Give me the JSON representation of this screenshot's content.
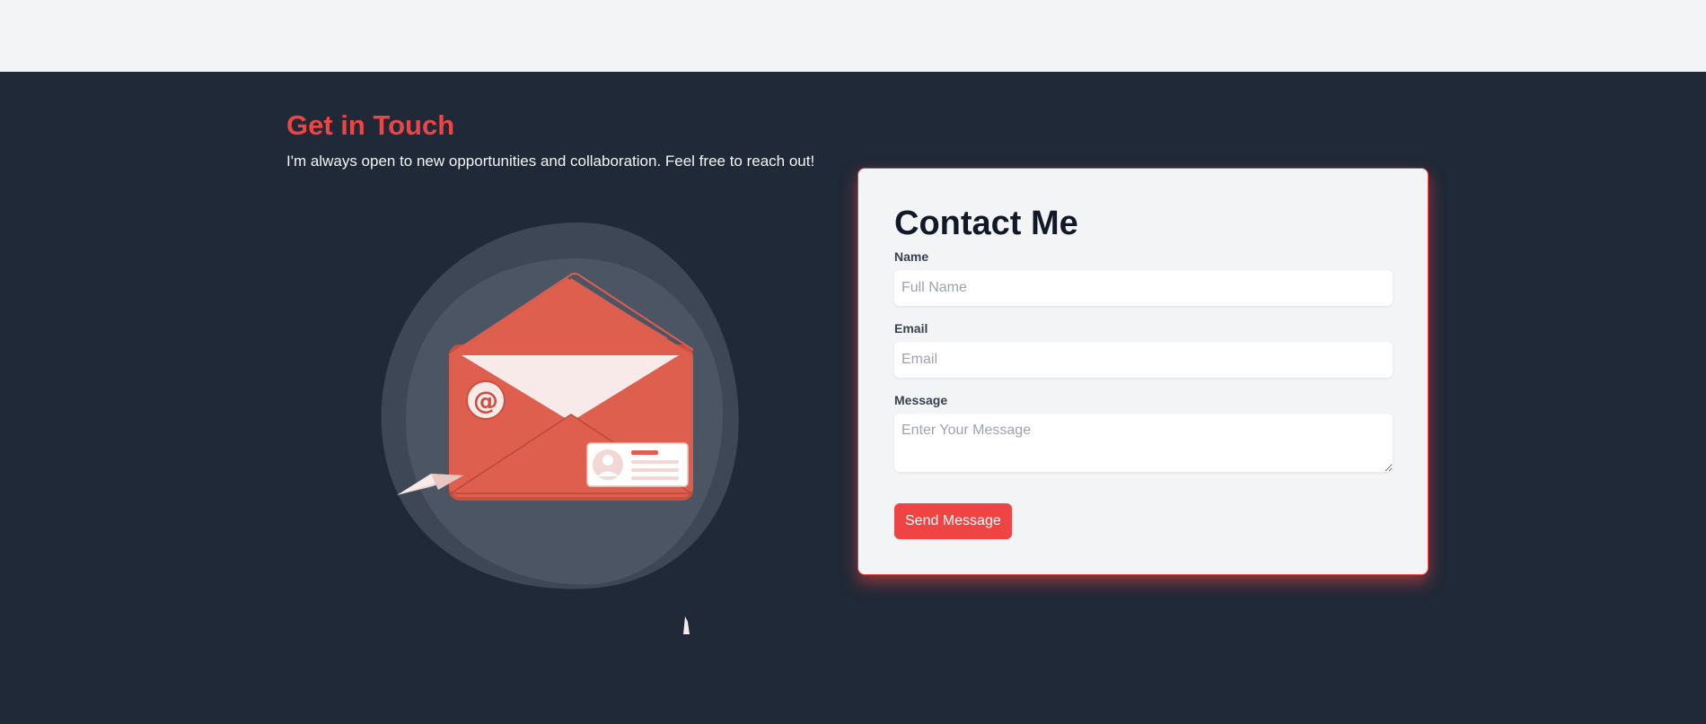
{
  "contact": {
    "heading": "Get in Touch",
    "subheading": "I'm always open to new opportunities and collaboration. Feel free to reach out!"
  },
  "form": {
    "title": "Contact Me",
    "name_label": "Name",
    "name_placeholder": "Full Name",
    "name_value": "",
    "email_label": "Email",
    "email_placeholder": "Email",
    "email_value": "",
    "message_label": "Message",
    "message_placeholder": "Enter Your Message",
    "message_value": "",
    "submit_label": "Send Message"
  },
  "illustration": {
    "icon": "envelope-with-at-sign-icon",
    "at_symbol": "@"
  },
  "colors": {
    "accent": "#ef4444",
    "section_background": "#1f2937",
    "top_bar_background": "#f3f4f6",
    "card_background": "#f3f4f6",
    "envelope": "#df5f4e"
  }
}
